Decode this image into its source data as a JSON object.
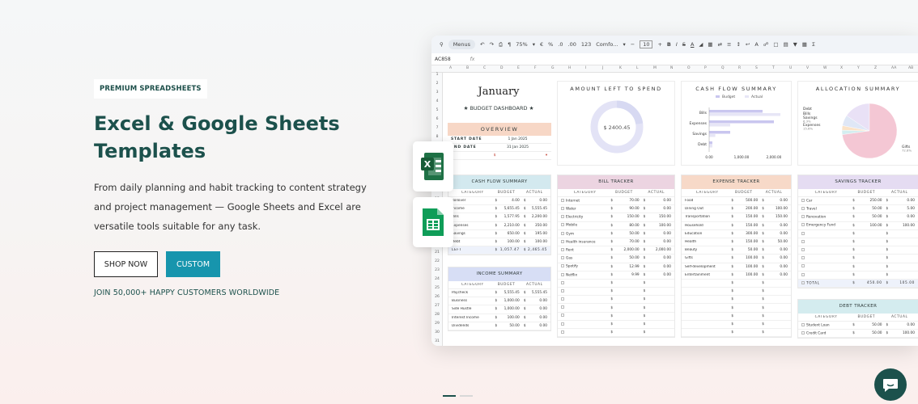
{
  "hero": {
    "badge": "PREMIUM SPREADSHEETS",
    "title_line1": "Excel & Google Sheets",
    "title_line2": "Templates",
    "desc_line1": "From daily planning and habit tracking to content strategy",
    "desc_line2": "and project management — Google Sheets and Excel are",
    "desc_line3": "versatile tools suitable for any task.",
    "shop_label": "SHOP NOW",
    "custom_label": "CUSTOM",
    "tagline": "JOIN 50,000+ HAPPY CUSTOMERS WORLDWIDE"
  },
  "colors": {
    "brand": "#1c514c",
    "accent": "#1795ad"
  },
  "carousel": {
    "count": 2,
    "active": 0
  },
  "sheet": {
    "toolbar": {
      "menus": "Menus",
      "zoom": "75%",
      "font": "Comfo...",
      "font_size": "10",
      "fmt1": "€",
      "fmt2": "%",
      "fmt3": ".0",
      "fmt4": ".00",
      "fmt5": "123"
    },
    "cell_ref": "AC858",
    "fx": "fx",
    "columns": [
      "A",
      "B",
      "C",
      "D",
      "E",
      "F",
      "G",
      "H",
      "I",
      "J",
      "K",
      "L",
      "M",
      "N",
      "O",
      "P",
      "Q",
      "R",
      "S",
      "T",
      "U",
      "V",
      "W",
      "X",
      "Y",
      "Z",
      "AA",
      "AB"
    ],
    "row_numbers": [
      "1",
      "2",
      "3",
      "4",
      "5",
      "6",
      "7",
      "8",
      "9",
      "10",
      "11",
      "12",
      "13",
      "14",
      "15",
      "16",
      "17",
      "18",
      "19",
      "20",
      "21",
      "22",
      "23",
      "24",
      "25",
      "26",
      "27",
      "28",
      "29",
      "30",
      "31"
    ],
    "month": "January",
    "dashboard_label": "★ BUDGET DASHBOARD ★",
    "overview": {
      "title": "OVERVIEW",
      "start_label": "START DATE",
      "start_value": "1 Jan 2025",
      "end_label": "END DATE",
      "end_value": "31 Jan 2025",
      "currency": "$"
    },
    "amount_left": {
      "title": "AMOUNT LEFT TO SPEND",
      "value": "$ 2400.45"
    },
    "cash_flow_chart": {
      "title": "CASH FLOW SUMMARY",
      "legend_budget": "Budget",
      "legend_actual": "Actual",
      "categories": [
        "Bills",
        "Expenses",
        "Savings",
        "Debt"
      ],
      "budget": [
        1650,
        2000,
        650,
        100
      ],
      "actual": [
        2200,
        650,
        190,
        100
      ],
      "ticks": [
        "0.00",
        "1,000.00",
        "2,000.00"
      ],
      "xlim": [
        0,
        2400
      ]
    },
    "allocation": {
      "title": "ALLOCATION SUMMARY",
      "labels": [
        "Debt",
        "Bills",
        "Savings",
        "Expenses",
        "Gifts"
      ],
      "pcts": [
        "",
        "",
        "6.3%",
        "15.6%",
        "72.8%"
      ],
      "values": [
        2.6,
        2.7,
        6.3,
        15.6,
        72.8
      ],
      "colors": [
        "#d4eef0",
        "#fbe3c8",
        "#dfe7f6",
        "#e9e1f6",
        "#f4c7d4"
      ]
    },
    "cash_flow_table": {
      "title": "CASH FLOW SUMMARY",
      "cols": [
        "CATEGORY",
        "BUDGET",
        "ACTUAL"
      ],
      "rows": [
        [
          "Rollover",
          "$",
          "4.00",
          "$",
          "0.00"
        ],
        [
          "Income",
          "$",
          "5,655.45",
          "$",
          "5,555.45"
        ],
        [
          "Bills",
          "$",
          "1,577.95",
          "$",
          "2,200.00"
        ],
        [
          "Expenses",
          "$",
          "2,210.00",
          "$",
          "350.00"
        ],
        [
          "Savings",
          "$",
          "650.00",
          "$",
          "195.00"
        ],
        [
          "Debt",
          "$",
          "100.00",
          "$",
          "100.00"
        ],
        [
          "LEFT",
          "$",
          "1,057.47",
          "$",
          "2,465.45"
        ]
      ]
    },
    "income_table": {
      "title": "INCOME SUMMARY",
      "cols": [
        "CATEGORY",
        "BUDGET",
        "ACTUAL"
      ],
      "rows": [
        [
          "Paycheck",
          "$",
          "5,555.45",
          "$",
          "5,555.45"
        ],
        [
          "Business",
          "$",
          "1,000.00",
          "$",
          "0.00"
        ],
        [
          "Side Hustle",
          "$",
          "1,000.00",
          "$",
          "0.00"
        ],
        [
          "Interest Income",
          "$",
          "100.00",
          "$",
          "0.00"
        ],
        [
          "Dividends",
          "$",
          "50.00",
          "$",
          "0.00"
        ]
      ]
    },
    "bill_table": {
      "title": "BILL TRACKER",
      "cols": [
        "CATEGORY",
        "BUDGET",
        "ACTUAL"
      ],
      "rows": [
        [
          "Internet",
          "$",
          "70.00",
          "$",
          "0.00"
        ],
        [
          "Water",
          "$",
          "90.00",
          "$",
          "0.00"
        ],
        [
          "Electricity",
          "$",
          "150.00",
          "$",
          "150.00"
        ],
        [
          "Mobile",
          "$",
          "80.00",
          "$",
          "100.00"
        ],
        [
          "Gym",
          "$",
          "50.00",
          "$",
          "0.00"
        ],
        [
          "Health insurance",
          "$",
          "70.00",
          "$",
          "0.00"
        ],
        [
          "Rent",
          "$",
          "2,000.00",
          "$",
          "2,000.00"
        ],
        [
          "Gas",
          "$",
          "50.00",
          "$",
          "0.00"
        ],
        [
          "Spotify",
          "$",
          "12.99",
          "$",
          "0.00"
        ],
        [
          "Netflix",
          "$",
          "9.99",
          "$",
          "0.00"
        ],
        [
          "",
          "$",
          "",
          "$",
          ""
        ],
        [
          "",
          "$",
          "",
          "$",
          ""
        ],
        [
          "",
          "$",
          "",
          "$",
          ""
        ],
        [
          "",
          "$",
          "",
          "$",
          ""
        ],
        [
          "",
          "$",
          "",
          "$",
          ""
        ],
        [
          "",
          "$",
          "",
          "$",
          ""
        ],
        [
          "",
          "$",
          "",
          "$",
          ""
        ]
      ]
    },
    "expense_table": {
      "title": "EXPENSE TRACKER",
      "cols": [
        "CATEGORY",
        "BUDGET",
        "ACTUAL"
      ],
      "rows": [
        [
          "Food",
          "$",
          "500.00",
          "$",
          "0.00"
        ],
        [
          "Dining Out",
          "$",
          "200.00",
          "$",
          "100.00"
        ],
        [
          "Transportation",
          "$",
          "150.00",
          "$",
          "150.00"
        ],
        [
          "Household",
          "$",
          "150.00",
          "$",
          "0.00"
        ],
        [
          "Education",
          "$",
          "300.00",
          "$",
          "0.00"
        ],
        [
          "Health",
          "$",
          "150.00",
          "$",
          "50.00"
        ],
        [
          "Beauty",
          "$",
          "50.00",
          "$",
          "0.00"
        ],
        [
          "Gifts",
          "$",
          "100.00",
          "$",
          "0.00"
        ],
        [
          "Self-development",
          "$",
          "100.00",
          "$",
          "0.00"
        ],
        [
          "Entertainment",
          "$",
          "100.00",
          "$",
          "0.00"
        ],
        [
          "",
          "$",
          "",
          "$",
          ""
        ],
        [
          "",
          "$",
          "",
          "$",
          ""
        ],
        [
          "",
          "$",
          "",
          "$",
          ""
        ],
        [
          "",
          "$",
          "",
          "$",
          ""
        ],
        [
          "",
          "$",
          "",
          "$",
          ""
        ],
        [
          "",
          "$",
          "",
          "$",
          ""
        ],
        [
          "",
          "$",
          "",
          "$",
          ""
        ]
      ]
    },
    "savings_table": {
      "title": "SAVINGS TRACKER",
      "cols": [
        "CATEGORY",
        "BUDGET",
        "ACTUAL"
      ],
      "rows": [
        [
          "Car",
          "$",
          "250.00",
          "$",
          "0.00"
        ],
        [
          "Travel",
          "$",
          "50.00",
          "$",
          "5.00"
        ],
        [
          "Renovation",
          "$",
          "50.00",
          "$",
          "0.00"
        ],
        [
          "Emergency Fund",
          "$",
          "100.00",
          "$",
          "100.00"
        ],
        [
          "",
          "$",
          "",
          "$",
          ""
        ],
        [
          "",
          "$",
          "",
          "$",
          ""
        ],
        [
          "",
          "$",
          "",
          "$",
          ""
        ],
        [
          "",
          "$",
          "",
          "$",
          ""
        ],
        [
          "",
          "$",
          "",
          "$",
          ""
        ],
        [
          "",
          "$",
          "",
          "$",
          ""
        ],
        [
          "TOTAL",
          "$",
          "450.00",
          "$",
          "105.00"
        ]
      ]
    },
    "debt_table": {
      "title": "DEBT TRACKER",
      "cols": [
        "CATEGORY",
        "BUDGET",
        "ACTUAL"
      ],
      "rows": [
        [
          "Student Loan",
          "$",
          "50.00",
          "$",
          "0.00"
        ],
        [
          "Credit Card",
          "$",
          "50.00",
          "$",
          "100.00"
        ]
      ]
    }
  }
}
